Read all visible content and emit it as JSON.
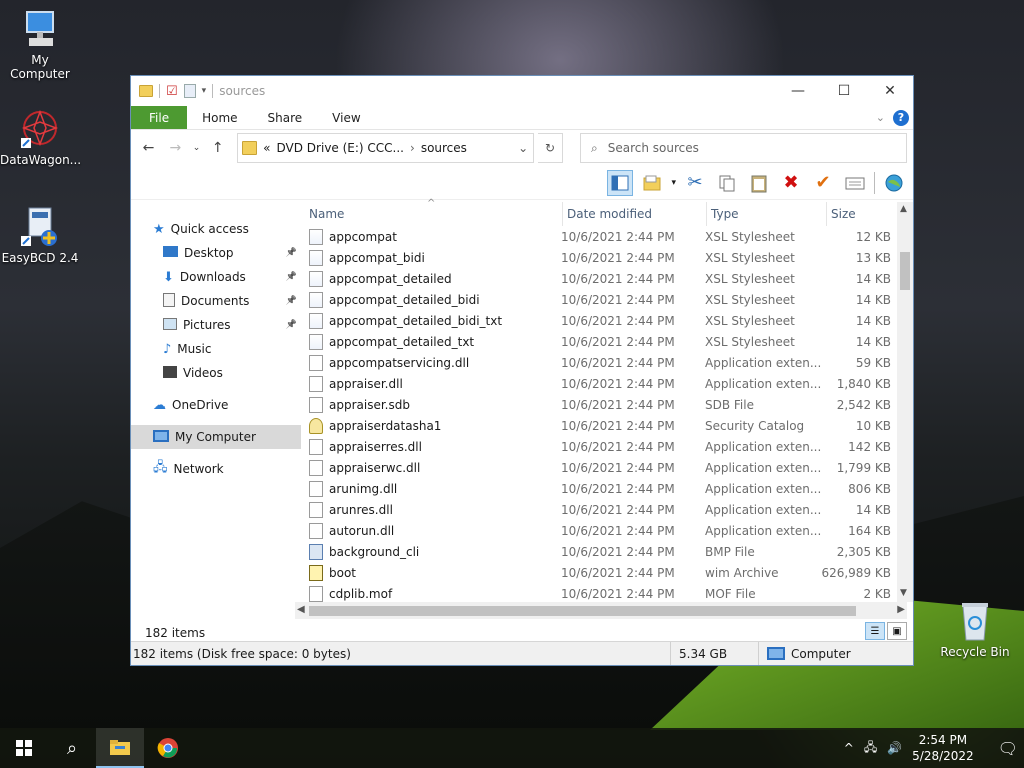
{
  "desktop": {
    "icons": [
      {
        "label": "My Computer"
      },
      {
        "label": "DataWagon..."
      },
      {
        "label": "EasyBCD 2.4"
      },
      {
        "label": "Recycle Bin"
      }
    ]
  },
  "window": {
    "title": "sources",
    "tabs": [
      "File",
      "Home",
      "Share",
      "View"
    ],
    "address": {
      "prefix": "«",
      "crumb1": "DVD Drive (E:) CCC...",
      "crumb2": "sources"
    },
    "search_placeholder": "Search sources",
    "nav": [
      {
        "label": "Quick access",
        "icon": "star-icon",
        "pinned": false,
        "sub": false
      },
      {
        "label": "Desktop",
        "icon": "desktop-icon",
        "pinned": true,
        "sub": true
      },
      {
        "label": "Downloads",
        "icon": "download-icon",
        "pinned": true,
        "sub": true
      },
      {
        "label": "Documents",
        "icon": "documents-icon",
        "pinned": true,
        "sub": true
      },
      {
        "label": "Pictures",
        "icon": "pictures-icon",
        "pinned": true,
        "sub": true
      },
      {
        "label": "Music",
        "icon": "music-icon",
        "pinned": false,
        "sub": true
      },
      {
        "label": "Videos",
        "icon": "videos-icon",
        "pinned": false,
        "sub": true
      },
      {
        "label": "OneDrive",
        "icon": "cloud-icon",
        "pinned": false,
        "sub": false,
        "gap": true
      },
      {
        "label": "My Computer",
        "icon": "computer-icon",
        "pinned": false,
        "sub": false,
        "gap": true,
        "selected": true
      },
      {
        "label": "Network",
        "icon": "network-icon",
        "pinned": false,
        "sub": false,
        "gap": true
      }
    ],
    "columns": {
      "name": "Name",
      "date": "Date modified",
      "type": "Type",
      "size": "Size"
    },
    "files": [
      {
        "name": "appcompat",
        "date": "10/6/2021 2:44 PM",
        "type": "XSL Stylesheet",
        "size": "12 KB",
        "kind": "xsl"
      },
      {
        "name": "appcompat_bidi",
        "date": "10/6/2021 2:44 PM",
        "type": "XSL Stylesheet",
        "size": "13 KB",
        "kind": "xsl"
      },
      {
        "name": "appcompat_detailed",
        "date": "10/6/2021 2:44 PM",
        "type": "XSL Stylesheet",
        "size": "14 KB",
        "kind": "xsl"
      },
      {
        "name": "appcompat_detailed_bidi",
        "date": "10/6/2021 2:44 PM",
        "type": "XSL Stylesheet",
        "size": "14 KB",
        "kind": "xsl"
      },
      {
        "name": "appcompat_detailed_bidi_txt",
        "date": "10/6/2021 2:44 PM",
        "type": "XSL Stylesheet",
        "size": "14 KB",
        "kind": "xsl"
      },
      {
        "name": "appcompat_detailed_txt",
        "date": "10/6/2021 2:44 PM",
        "type": "XSL Stylesheet",
        "size": "14 KB",
        "kind": "xsl"
      },
      {
        "name": "appcompatservicing.dll",
        "date": "10/6/2021 2:44 PM",
        "type": "Application exten...",
        "size": "59 KB",
        "kind": "dll"
      },
      {
        "name": "appraiser.dll",
        "date": "10/6/2021 2:44 PM",
        "type": "Application exten...",
        "size": "1,840 KB",
        "kind": "dll"
      },
      {
        "name": "appraiser.sdb",
        "date": "10/6/2021 2:44 PM",
        "type": "SDB File",
        "size": "2,542 KB",
        "kind": "file"
      },
      {
        "name": "appraiserdatasha1",
        "date": "10/6/2021 2:44 PM",
        "type": "Security Catalog",
        "size": "10 KB",
        "kind": "cat"
      },
      {
        "name": "appraiserres.dll",
        "date": "10/6/2021 2:44 PM",
        "type": "Application exten...",
        "size": "142 KB",
        "kind": "dll"
      },
      {
        "name": "appraiserwc.dll",
        "date": "10/6/2021 2:44 PM",
        "type": "Application exten...",
        "size": "1,799 KB",
        "kind": "dll"
      },
      {
        "name": "arunimg.dll",
        "date": "10/6/2021 2:44 PM",
        "type": "Application exten...",
        "size": "806 KB",
        "kind": "dll"
      },
      {
        "name": "arunres.dll",
        "date": "10/6/2021 2:44 PM",
        "type": "Application exten...",
        "size": "14 KB",
        "kind": "dll"
      },
      {
        "name": "autorun.dll",
        "date": "10/6/2021 2:44 PM",
        "type": "Application exten...",
        "size": "164 KB",
        "kind": "dll"
      },
      {
        "name": "background_cli",
        "date": "10/6/2021 2:44 PM",
        "type": "BMP File",
        "size": "2,305 KB",
        "kind": "bmp"
      },
      {
        "name": "boot",
        "date": "10/6/2021 2:44 PM",
        "type": "wim Archive",
        "size": "626,989 KB",
        "kind": "wim"
      },
      {
        "name": "cdplib.mof",
        "date": "10/6/2021 2:44 PM",
        "type": "MOF File",
        "size": "2 KB",
        "kind": "file"
      }
    ],
    "item_count": "182 items",
    "status": {
      "left": "182 items (Disk free space: 0 bytes)",
      "size": "5.34 GB",
      "location": "Computer"
    }
  },
  "taskbar": {
    "time": "2:54 PM",
    "date": "5/28/2022"
  }
}
